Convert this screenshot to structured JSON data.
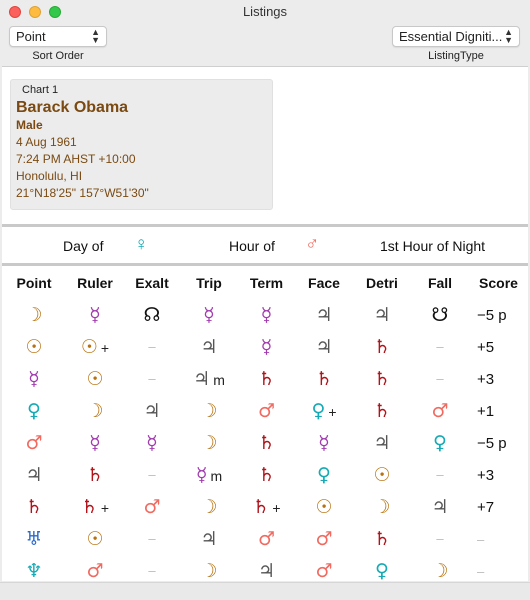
{
  "window": {
    "title": "Listings"
  },
  "toolbar": {
    "sort_popup_value": "Point",
    "sort_caption": "Sort Order",
    "listing_popup_value": "Essential Digniti...",
    "listing_caption": "ListingType"
  },
  "chart": {
    "label": "Chart 1",
    "name": "Barack Obama",
    "gender": "Male",
    "date": "4 Aug 1961",
    "time": "7:24 PM AHST +10:00",
    "place": "Honolulu, HI",
    "coords": "21°N18'25\" 157°W51'30\""
  },
  "day_info": {
    "day_label": "Day of",
    "day_glyph": "♀",
    "hour_label": "Hour of",
    "hour_glyph": "♂",
    "night_label": "1st Hour of Night"
  },
  "table": {
    "headers": [
      "Point",
      "Ruler",
      "Exalt",
      "Trip",
      "Term",
      "Face",
      "Detri",
      "Fall",
      "Score"
    ],
    "rows": [
      [
        {
          "g": "☽"
        },
        {
          "g": "☿"
        },
        {
          "g": "☊"
        },
        {
          "g": "☿"
        },
        {
          "g": "☿"
        },
        {
          "g": "♃"
        },
        {
          "g": "♃"
        },
        {
          "g": "☋"
        },
        {
          "t": "−5 p"
        }
      ],
      [
        {
          "g": "☉"
        },
        {
          "g": "☉",
          "s": "+"
        },
        {
          "d": "–"
        },
        {
          "g": "♃"
        },
        {
          "g": "☿"
        },
        {
          "g": "♃"
        },
        {
          "g": "♄"
        },
        {
          "d": "–"
        },
        {
          "t": "+5"
        }
      ],
      [
        {
          "g": "☿"
        },
        {
          "g": "☉"
        },
        {
          "d": "–"
        },
        {
          "g": "♃",
          "s": "m"
        },
        {
          "g": "♄"
        },
        {
          "g": "♄"
        },
        {
          "g": "♄"
        },
        {
          "d": "–"
        },
        {
          "t": "+3"
        }
      ],
      [
        {
          "g": "♀"
        },
        {
          "g": "☽"
        },
        {
          "g": "♃"
        },
        {
          "g": "☽"
        },
        {
          "g": "♂"
        },
        {
          "g": "♀",
          "s": "+"
        },
        {
          "g": "♄"
        },
        {
          "g": "♂"
        },
        {
          "t": "+1"
        }
      ],
      [
        {
          "g": "♂"
        },
        {
          "g": "☿"
        },
        {
          "g": "☿"
        },
        {
          "g": "☽"
        },
        {
          "g": "♄"
        },
        {
          "g": "☿"
        },
        {
          "g": "♃"
        },
        {
          "g": "♀"
        },
        {
          "t": "−5 p"
        }
      ],
      [
        {
          "g": "♃"
        },
        {
          "g": "♄"
        },
        {
          "d": "–"
        },
        {
          "g": "☿",
          "s": "m"
        },
        {
          "g": "♄"
        },
        {
          "g": "♀"
        },
        {
          "g": "☉"
        },
        {
          "d": "–"
        },
        {
          "t": "+3"
        }
      ],
      [
        {
          "g": "♄"
        },
        {
          "g": "♄",
          "s": "+"
        },
        {
          "g": "♂"
        },
        {
          "g": "☽"
        },
        {
          "g": "♄",
          "s": "+"
        },
        {
          "g": "☉"
        },
        {
          "g": "☽"
        },
        {
          "g": "♃"
        },
        {
          "t": "+7"
        }
      ],
      [
        {
          "g": "♅"
        },
        {
          "g": "☉"
        },
        {
          "d": "–"
        },
        {
          "g": "♃"
        },
        {
          "g": "♂"
        },
        {
          "g": "♂"
        },
        {
          "g": "♄"
        },
        {
          "d": "–"
        },
        {
          "t": "–"
        }
      ],
      [
        {
          "g": "♆"
        },
        {
          "g": "♂"
        },
        {
          "d": "–"
        },
        {
          "g": "☽"
        },
        {
          "g": "♃"
        },
        {
          "g": "♂"
        },
        {
          "g": "♀"
        },
        {
          "g": "☽"
        },
        {
          "t": "–"
        }
      ]
    ]
  },
  "colors": {
    "☽": "#b8720f",
    "☉": "#b8720f",
    "☿": "#a33bb0",
    "♀": "#15aab5",
    "♂": "#f16a60",
    "♃": "#555555",
    "♄": "#b0141b",
    "♅": "#2a6acb",
    "♆": "#15aab5",
    "☊": "#111111",
    "☋": "#111111",
    "text": "#7a4a12"
  }
}
